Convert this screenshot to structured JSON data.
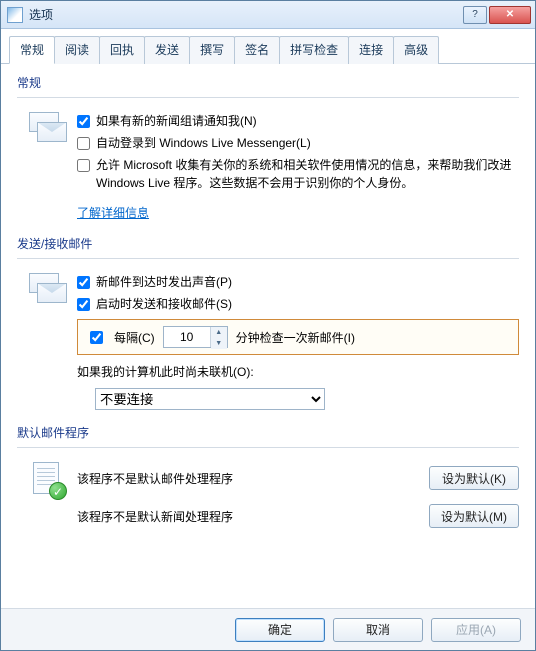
{
  "window": {
    "title": "选项"
  },
  "tabs": [
    "常规",
    "阅读",
    "回执",
    "发送",
    "撰写",
    "签名",
    "拼写检查",
    "连接",
    "高级"
  ],
  "active_tab": 0,
  "general": {
    "header": "常规",
    "notify_newsgroup": "如果有新的新闻组请通知我(N)",
    "auto_login": "自动登录到 Windows Live Messenger(L)",
    "allow_ms": "允许 Microsoft 收集有关你的系统和相关软件使用情况的信息，来帮助我们改进 Windows Live 程序。这些数据不会用于识别你的个人身份。",
    "learn_more": "了解详细信息",
    "checks": {
      "notify": true,
      "auto_login": false,
      "allow_ms": false
    }
  },
  "sendrecv": {
    "header": "发送/接收邮件",
    "play_sound": "新邮件到达时发出声音(P)",
    "on_startup": "启动时发送和接收邮件(S)",
    "every_label": "每隔(C)",
    "interval_value": "10",
    "minutes_suffix": "分钟检查一次新邮件(I)",
    "offline_label": "如果我的计算机此时尚未联机(O):",
    "offline_value": "不要连接",
    "checks": {
      "play": true,
      "startup": true,
      "every": true
    }
  },
  "defaults": {
    "header": "默认邮件程序",
    "mail_text": "该程序不是默认邮件处理程序",
    "news_text": "该程序不是默认新闻处理程序",
    "set_default_k": "设为默认(K)",
    "set_default_m": "设为默认(M)"
  },
  "footer": {
    "ok": "确定",
    "cancel": "取消",
    "apply": "应用(A)"
  }
}
